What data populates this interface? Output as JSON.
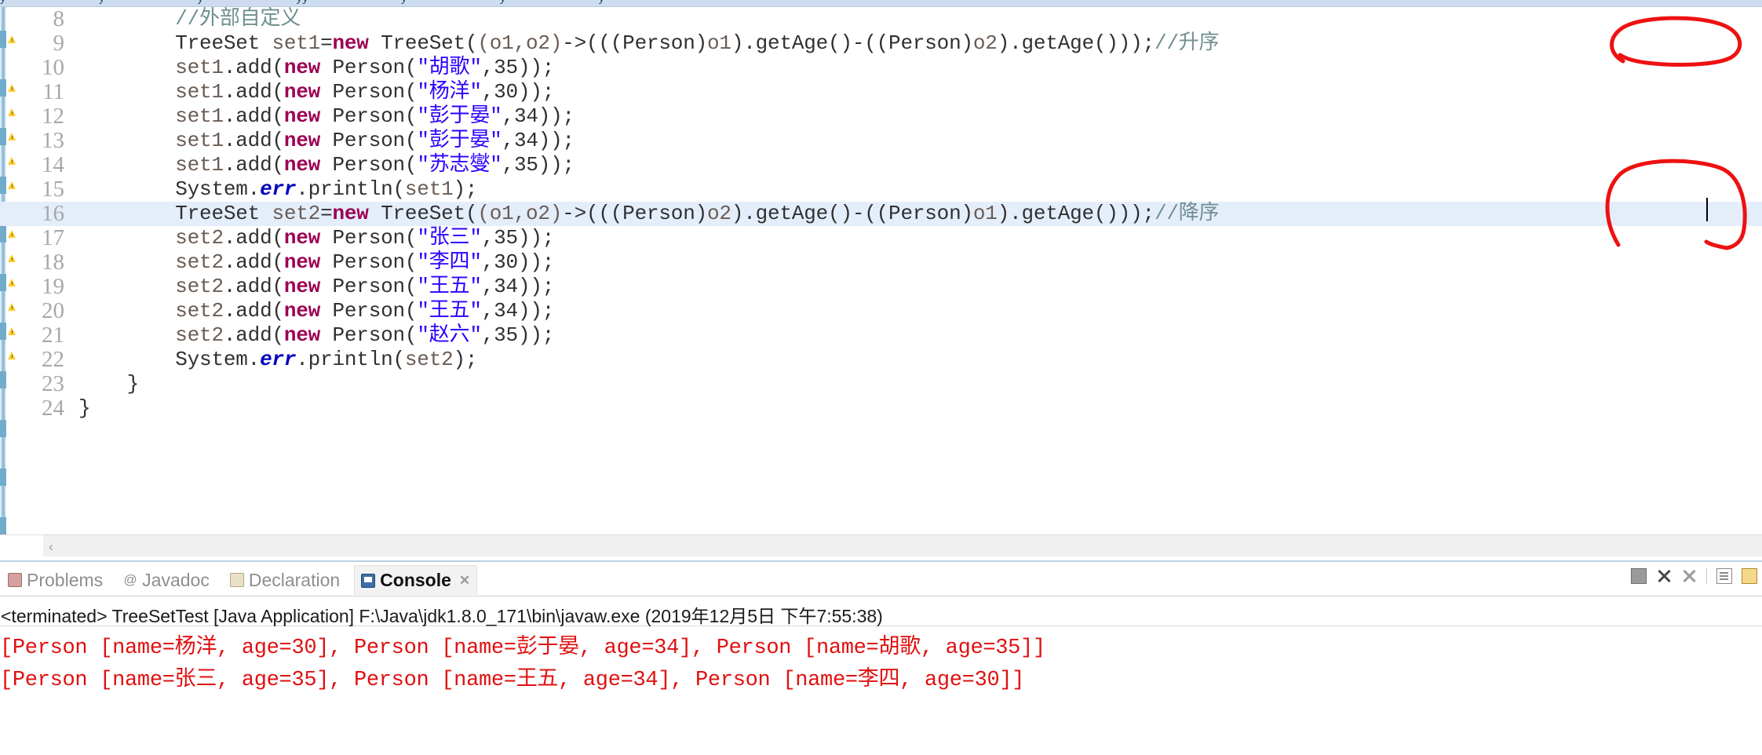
{
  "app": {
    "ide": "Eclipse",
    "accent_highlight": "#e4eefb",
    "annotation_color": "#ee1111",
    "console_error_color": "#e01010"
  },
  "top_strip": {
    "ghost_labels": [
      "y",
      "y",
      "y",
      "y",
      "yy",
      "y",
      "y",
      "y"
    ]
  },
  "editor": {
    "current_line": 16,
    "lines": [
      {
        "n": "8",
        "segments": [
          {
            "t": "        ",
            "c": "plain"
          },
          {
            "t": "//外部自定义",
            "c": "cmt"
          }
        ]
      },
      {
        "n": "9",
        "segments": [
          {
            "t": "        ",
            "c": "plain"
          },
          {
            "t": "TreeSet",
            "c": "plain"
          },
          {
            "t": " ",
            "c": "plain"
          },
          {
            "t": "set1",
            "c": "loc"
          },
          {
            "t": "=",
            "c": "plain"
          },
          {
            "t": "new",
            "c": "kw"
          },
          {
            "t": " TreeSet(",
            "c": "plain"
          },
          {
            "t": "(o1,o2)",
            "c": "loc"
          },
          {
            "t": "->(((Person)",
            "c": "plain"
          },
          {
            "t": "o1",
            "c": "loc"
          },
          {
            "t": ").getAge()-((Person)",
            "c": "plain"
          },
          {
            "t": "o2",
            "c": "loc"
          },
          {
            "t": ").getAge()));",
            "c": "plain"
          },
          {
            "t": "//升序",
            "c": "cmt"
          }
        ]
      },
      {
        "n": "10",
        "segments": [
          {
            "t": "        ",
            "c": "plain"
          },
          {
            "t": "set1",
            "c": "loc"
          },
          {
            "t": ".add(",
            "c": "plain"
          },
          {
            "t": "new",
            "c": "kw"
          },
          {
            "t": " Person(",
            "c": "plain"
          },
          {
            "t": "\"胡歌\"",
            "c": "str"
          },
          {
            "t": ",35));",
            "c": "plain"
          }
        ]
      },
      {
        "n": "11",
        "segments": [
          {
            "t": "        ",
            "c": "plain"
          },
          {
            "t": "set1",
            "c": "loc"
          },
          {
            "t": ".add(",
            "c": "plain"
          },
          {
            "t": "new",
            "c": "kw"
          },
          {
            "t": " Person(",
            "c": "plain"
          },
          {
            "t": "\"杨洋\"",
            "c": "str"
          },
          {
            "t": ",30));",
            "c": "plain"
          }
        ]
      },
      {
        "n": "12",
        "segments": [
          {
            "t": "        ",
            "c": "plain"
          },
          {
            "t": "set1",
            "c": "loc"
          },
          {
            "t": ".add(",
            "c": "plain"
          },
          {
            "t": "new",
            "c": "kw"
          },
          {
            "t": " Person(",
            "c": "plain"
          },
          {
            "t": "\"彭于晏\"",
            "c": "str"
          },
          {
            "t": ",34));",
            "c": "plain"
          }
        ]
      },
      {
        "n": "13",
        "segments": [
          {
            "t": "        ",
            "c": "plain"
          },
          {
            "t": "set1",
            "c": "loc"
          },
          {
            "t": ".add(",
            "c": "plain"
          },
          {
            "t": "new",
            "c": "kw"
          },
          {
            "t": " Person(",
            "c": "plain"
          },
          {
            "t": "\"彭于晏\"",
            "c": "str"
          },
          {
            "t": ",34));",
            "c": "plain"
          }
        ]
      },
      {
        "n": "14",
        "segments": [
          {
            "t": "        ",
            "c": "plain"
          },
          {
            "t": "set1",
            "c": "loc"
          },
          {
            "t": ".add(",
            "c": "plain"
          },
          {
            "t": "new",
            "c": "kw"
          },
          {
            "t": " Person(",
            "c": "plain"
          },
          {
            "t": "\"苏志燮\"",
            "c": "str"
          },
          {
            "t": ",35));",
            "c": "plain"
          }
        ]
      },
      {
        "n": "15",
        "segments": [
          {
            "t": "        ",
            "c": "plain"
          },
          {
            "t": "System.",
            "c": "plain"
          },
          {
            "t": "err",
            "c": "fld"
          },
          {
            "t": ".println(",
            "c": "plain"
          },
          {
            "t": "set1",
            "c": "loc"
          },
          {
            "t": ");",
            "c": "plain"
          }
        ]
      },
      {
        "n": "16",
        "segments": [
          {
            "t": "        ",
            "c": "plain"
          },
          {
            "t": "TreeSet",
            "c": "plain"
          },
          {
            "t": " ",
            "c": "plain"
          },
          {
            "t": "set2",
            "c": "loc"
          },
          {
            "t": "=",
            "c": "plain"
          },
          {
            "t": "new",
            "c": "kw"
          },
          {
            "t": " TreeSet(",
            "c": "plain"
          },
          {
            "t": "(o1,o2)",
            "c": "loc"
          },
          {
            "t": "->(((Person)",
            "c": "plain"
          },
          {
            "t": "o2",
            "c": "loc"
          },
          {
            "t": ").getAge()-((Person)",
            "c": "plain"
          },
          {
            "t": "o1",
            "c": "loc"
          },
          {
            "t": ").getAge()));",
            "c": "plain"
          },
          {
            "t": "//降序",
            "c": "cmt"
          }
        ]
      },
      {
        "n": "17",
        "segments": [
          {
            "t": "        ",
            "c": "plain"
          },
          {
            "t": "set2",
            "c": "loc"
          },
          {
            "t": ".add(",
            "c": "plain"
          },
          {
            "t": "new",
            "c": "kw"
          },
          {
            "t": " Person(",
            "c": "plain"
          },
          {
            "t": "\"张三\"",
            "c": "str"
          },
          {
            "t": ",35));",
            "c": "plain"
          }
        ]
      },
      {
        "n": "18",
        "segments": [
          {
            "t": "        ",
            "c": "plain"
          },
          {
            "t": "set2",
            "c": "loc"
          },
          {
            "t": ".add(",
            "c": "plain"
          },
          {
            "t": "new",
            "c": "kw"
          },
          {
            "t": " Person(",
            "c": "plain"
          },
          {
            "t": "\"李四\"",
            "c": "str"
          },
          {
            "t": ",30));",
            "c": "plain"
          }
        ]
      },
      {
        "n": "19",
        "segments": [
          {
            "t": "        ",
            "c": "plain"
          },
          {
            "t": "set2",
            "c": "loc"
          },
          {
            "t": ".add(",
            "c": "plain"
          },
          {
            "t": "new",
            "c": "kw"
          },
          {
            "t": " Person(",
            "c": "plain"
          },
          {
            "t": "\"王五\"",
            "c": "str"
          },
          {
            "t": ",34));",
            "c": "plain"
          }
        ]
      },
      {
        "n": "20",
        "segments": [
          {
            "t": "        ",
            "c": "plain"
          },
          {
            "t": "set2",
            "c": "loc"
          },
          {
            "t": ".add(",
            "c": "plain"
          },
          {
            "t": "new",
            "c": "kw"
          },
          {
            "t": " Person(",
            "c": "plain"
          },
          {
            "t": "\"王五\"",
            "c": "str"
          },
          {
            "t": ",34));",
            "c": "plain"
          }
        ]
      },
      {
        "n": "21",
        "segments": [
          {
            "t": "        ",
            "c": "plain"
          },
          {
            "t": "set2",
            "c": "loc"
          },
          {
            "t": ".add(",
            "c": "plain"
          },
          {
            "t": "new",
            "c": "kw"
          },
          {
            "t": " Person(",
            "c": "plain"
          },
          {
            "t": "\"赵六\"",
            "c": "str"
          },
          {
            "t": ",35));",
            "c": "plain"
          }
        ]
      },
      {
        "n": "22",
        "segments": [
          {
            "t": "        ",
            "c": "plain"
          },
          {
            "t": "System.",
            "c": "plain"
          },
          {
            "t": "err",
            "c": "fld"
          },
          {
            "t": ".println(",
            "c": "plain"
          },
          {
            "t": "set2",
            "c": "loc"
          },
          {
            "t": ");",
            "c": "plain"
          }
        ]
      },
      {
        "n": "23",
        "segments": [
          {
            "t": "    }",
            "c": "plain"
          }
        ]
      },
      {
        "n": "24",
        "segments": [
          {
            "t": "}",
            "c": "plain"
          }
        ]
      }
    ]
  },
  "annotations": [
    {
      "id": "circle-ascending",
      "label": "升序",
      "target_line": 9,
      "shape": "hand-drawn-oval"
    },
    {
      "id": "circle-descending",
      "label": "降序",
      "target_line": 16,
      "shape": "hand-drawn-oval"
    }
  ],
  "scrollbar": {
    "left_arrow": "‹"
  },
  "console": {
    "tabs": [
      {
        "id": "problems",
        "label": "Problems",
        "icon": "problems-icon",
        "active": false
      },
      {
        "id": "javadoc",
        "label": "Javadoc",
        "icon": "javadoc-icon",
        "active": false
      },
      {
        "id": "declaration",
        "label": "Declaration",
        "icon": "declaration-icon",
        "active": false
      },
      {
        "id": "console",
        "label": "Console",
        "icon": "console-icon",
        "active": true,
        "close": "✕"
      }
    ],
    "toolbar": [
      {
        "id": "scroll-lock",
        "icon": "grid-icon"
      },
      {
        "id": "terminate",
        "icon": "terminate-x-icon"
      },
      {
        "id": "remove-launch",
        "icon": "remove-all-x-icon"
      },
      {
        "id": "separator",
        "icon": "separator"
      },
      {
        "id": "clear-console",
        "icon": "clear-console-icon"
      },
      {
        "id": "pin-console",
        "icon": "pin-console-icon"
      }
    ],
    "launch_line": "<terminated> TreeSetTest [Java Application] F:\\Java\\jdk1.8.0_171\\bin\\javaw.exe (2019年12月5日 下午7:55:38)",
    "output": [
      "[Person [name=杨洋, age=30], Person [name=彭于晏, age=34], Person [name=胡歌, age=35]]",
      "[Person [name=张三, age=35], Person [name=王五, age=34], Person [name=李四, age=30]]"
    ]
  }
}
